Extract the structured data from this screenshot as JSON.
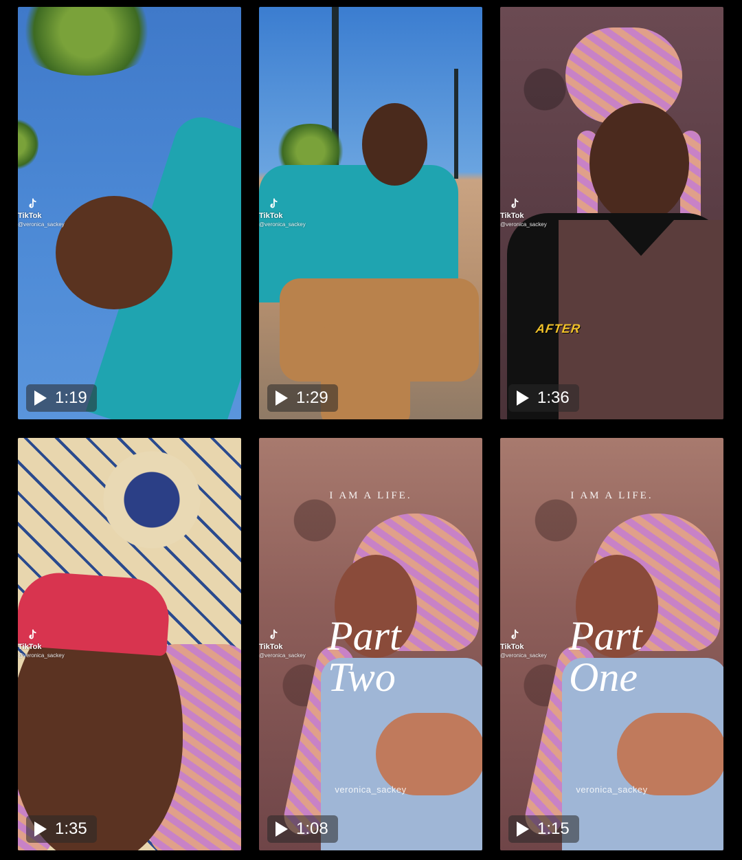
{
  "videos": [
    {
      "duration": "1:19",
      "watermark_brand": "TikTok",
      "watermark_handle": "@veronica_sackey"
    },
    {
      "duration": "1:29",
      "watermark_brand": "TikTok",
      "watermark_handle": "@veronica_sackey"
    },
    {
      "duration": "1:36",
      "watermark_brand": "TikTok",
      "watermark_handle": "@veronica_sackey",
      "overlay_text": "AFTER"
    },
    {
      "duration": "1:35",
      "watermark_brand": "TikTok",
      "watermark_handle": "@veronica_sackey"
    },
    {
      "duration": "1:08",
      "watermark_brand": "TikTok",
      "watermark_handle": "@veronica_sackey",
      "tagline": "I AM A LIFE.",
      "title_line1": "Part",
      "title_line2": "Two",
      "signature": "veronica_sackey"
    },
    {
      "duration": "1:15",
      "watermark_brand": "TikTok",
      "watermark_handle": "@veronica_sackey",
      "tagline": "I AM A LIFE.",
      "title_line1": "Part",
      "title_line2": "One",
      "signature": "veronica_sackey"
    }
  ],
  "colors": {
    "background": "#000000",
    "overlay_accent": "#f1c22a",
    "play_pill": "rgba(40,40,40,0.55)"
  },
  "icons": {
    "play": "play-icon",
    "tiktok": "tiktok-logo-icon"
  }
}
